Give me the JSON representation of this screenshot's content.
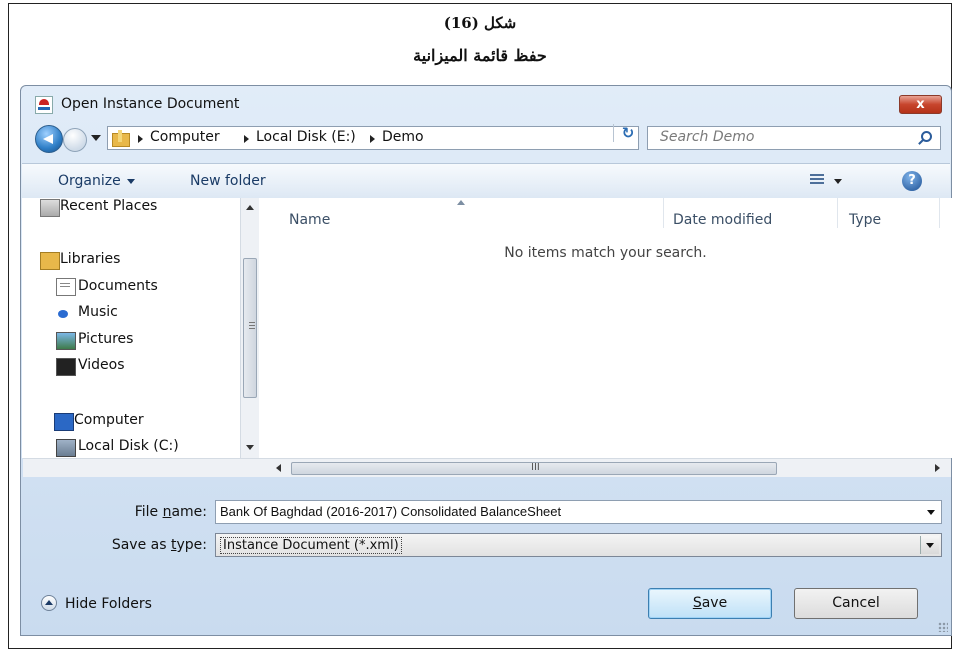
{
  "caption": {
    "figure": "شكل (16)",
    "title": "حفظ قائمة الميزانية"
  },
  "dialog": {
    "title": "Open Instance Document",
    "close_label": "x"
  },
  "address": {
    "crumbs": [
      "Computer",
      "Local Disk (E:)",
      "Demo"
    ],
    "search_placeholder": "Search Demo"
  },
  "toolbar": {
    "organize": "Organize",
    "new_folder": "New folder",
    "help": "?"
  },
  "nav": {
    "items": [
      {
        "label": "Recent Places",
        "icon": "recent-places-icon"
      },
      {
        "label": "Libraries",
        "icon": "libraries-icon"
      },
      {
        "label": "Documents",
        "icon": "documents-icon"
      },
      {
        "label": "Music",
        "icon": "music-icon"
      },
      {
        "label": "Pictures",
        "icon": "pictures-icon"
      },
      {
        "label": "Videos",
        "icon": "videos-icon"
      },
      {
        "label": "Computer",
        "icon": "computer-icon"
      },
      {
        "label": "Local Disk (C:)",
        "icon": "local-disk-icon"
      }
    ],
    "grip": "≡"
  },
  "files": {
    "columns": [
      "Name",
      "Date modified",
      "Type"
    ],
    "empty_message": "No items match your search.",
    "hscroll_grip": "III"
  },
  "form": {
    "file_name_label_pre": "File ",
    "file_name_label_u": "n",
    "file_name_label_post": "ame:",
    "file_name_value": "Bank Of Baghdad (2016-2017) Consolidated BalanceSheet",
    "save_type_label_pre": "Save as ",
    "save_type_label_u": "t",
    "save_type_label_post": "ype:",
    "save_type_value": "Instance Document (*.xml)"
  },
  "footer": {
    "hide_folders": "Hide Folders",
    "save_u": "S",
    "save_rest": "ave",
    "cancel": "Cancel"
  }
}
